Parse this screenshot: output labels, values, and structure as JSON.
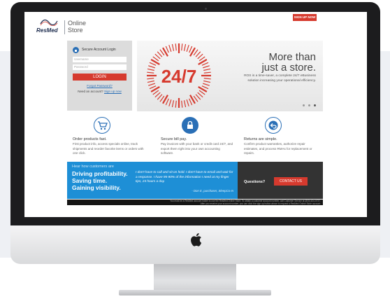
{
  "logo": {
    "brand": "ResMed",
    "store_line1": "Online",
    "store_line2": "Store"
  },
  "header": {
    "signup_label": "SIGN UP NOW"
  },
  "login": {
    "title": "Secure Account Login",
    "username_placeholder": "Username",
    "password_placeholder": "Password",
    "login_label": "LOGIN",
    "forgot_label": "Forgot Password?",
    "need_account": "Need an account?",
    "signup_link": "Sign up now"
  },
  "hero": {
    "badge": "24/7",
    "headline1": "More than",
    "headline2": "just a store.",
    "text": "ROS is a time-saver, a complete 24/7 eBusiness solution increasing your operational efficiency.",
    "slide_count": 3,
    "active_slide": 3
  },
  "features": [
    {
      "icon": "cart-icon",
      "title": "Order products fast.",
      "text": "First product info, access specials online, track shipments and reorder favorite items or orders with one click."
    },
    {
      "icon": "lock-icon",
      "title": "Secure bill pay.",
      "text": "Pay invoices with your bank or credit card 24/7, and export them right into your own accounting software."
    },
    {
      "icon": "return-icon",
      "title": "Returns are simple.",
      "text": "Confirm product warranties, authorize repair estimates, and process RMAs for replacement or repairs."
    }
  ],
  "testimonial": {
    "heading": "Hear how customers are",
    "line1": "Driving profitability.",
    "line2": "Saving time.",
    "line3": "Gaining visibility.",
    "quote": "I don't have to call and sit on hold. I don't have to email and wait for a response. I have 95-90% of the information I need at my finger tips, 24 hours a day.",
    "author": "- Don E, purchaser, SleepCo-In"
  },
  "questions": {
    "label": "Questions?",
    "button": "CONTACT US"
  },
  "footer": {
    "line1": "You must be a ResMed account holder to use the ResMed Online Store. To obtain a customer account number, call Customer Service at (800) 424-0737.",
    "line2": "After you receive your account number, you can click the sign up button above to request a ResMed Online Store account."
  },
  "colors": {
    "brand_red": "#d63a2e",
    "brand_blue": "#2a6fb6",
    "testimonial_blue": "#1e8fd6",
    "dark_panel": "#333333"
  }
}
